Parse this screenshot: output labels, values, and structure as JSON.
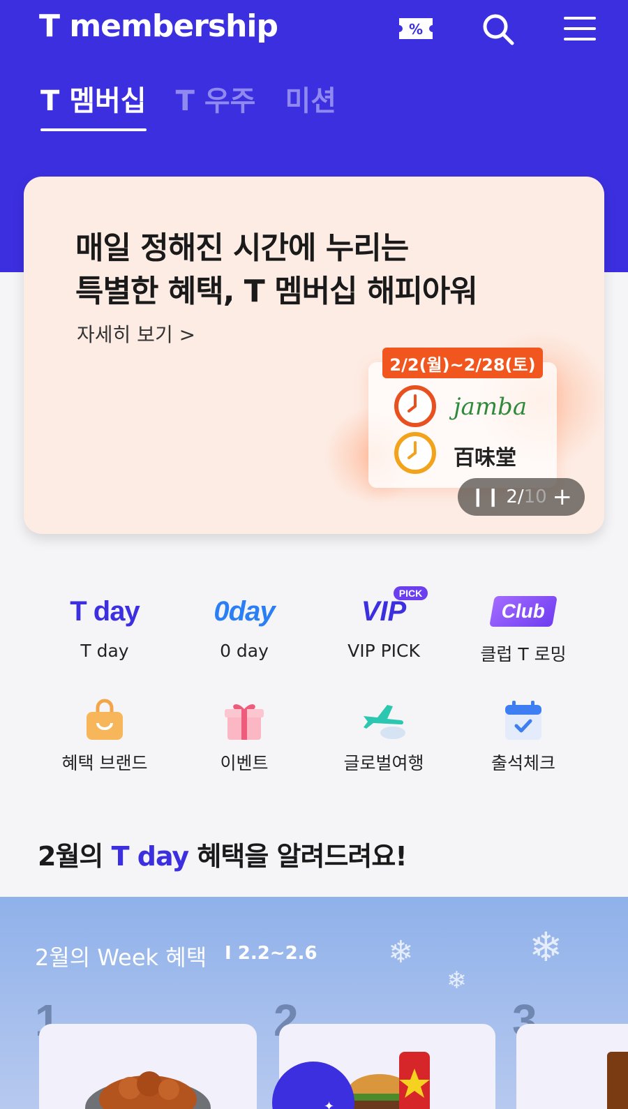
{
  "header": {
    "logo": "T membership",
    "tabs": [
      {
        "label": "T 멤버십",
        "active": true
      },
      {
        "label": "T 우주",
        "active": false
      },
      {
        "label": "미션",
        "active": false
      }
    ],
    "icons": [
      "coupon-icon",
      "search-icon",
      "menu-icon"
    ]
  },
  "banner": {
    "title_line1": "매일 정해진 시간에 누리는",
    "title_line2": "특별한 혜택, T 멤버십 해피아워",
    "more_link": "자세히 보기 >",
    "date_badge": "2/2(월)~2/28(토)",
    "brand1": "jamba",
    "brand2": "百味堂",
    "pager_current": "2/",
    "pager_total": "10"
  },
  "shortcuts": [
    {
      "label": "T day",
      "icon": "tday-logo"
    },
    {
      "label": "0 day",
      "icon": "oday-logo"
    },
    {
      "label": "VIP PICK",
      "icon": "vip-pick-logo"
    },
    {
      "label": "클럽 T 로밍",
      "icon": "club-logo"
    },
    {
      "label": "혜택 브랜드",
      "icon": "shopping-bag-icon"
    },
    {
      "label": "이벤트",
      "icon": "gift-icon"
    },
    {
      "label": "글로벌여행",
      "icon": "airplane-icon"
    },
    {
      "label": "출석체크",
      "icon": "calendar-check-icon"
    }
  ],
  "logos": {
    "tday": "T day",
    "oday": "0day",
    "vip": "VIP",
    "vip_pick": "PICK",
    "club": "Club"
  },
  "section": {
    "title_pre": "2월의 ",
    "title_accent": "T day",
    "title_post": " 혜택을 알려드려요!"
  },
  "week": {
    "title": "2월의 Week 혜택",
    "range": "I  2.2~2.6",
    "numbers": [
      "1",
      "2",
      "3"
    ]
  },
  "colors": {
    "brand": "#3c2fe0",
    "banner_bg": "#fdece4",
    "badge": "#f0561e"
  }
}
